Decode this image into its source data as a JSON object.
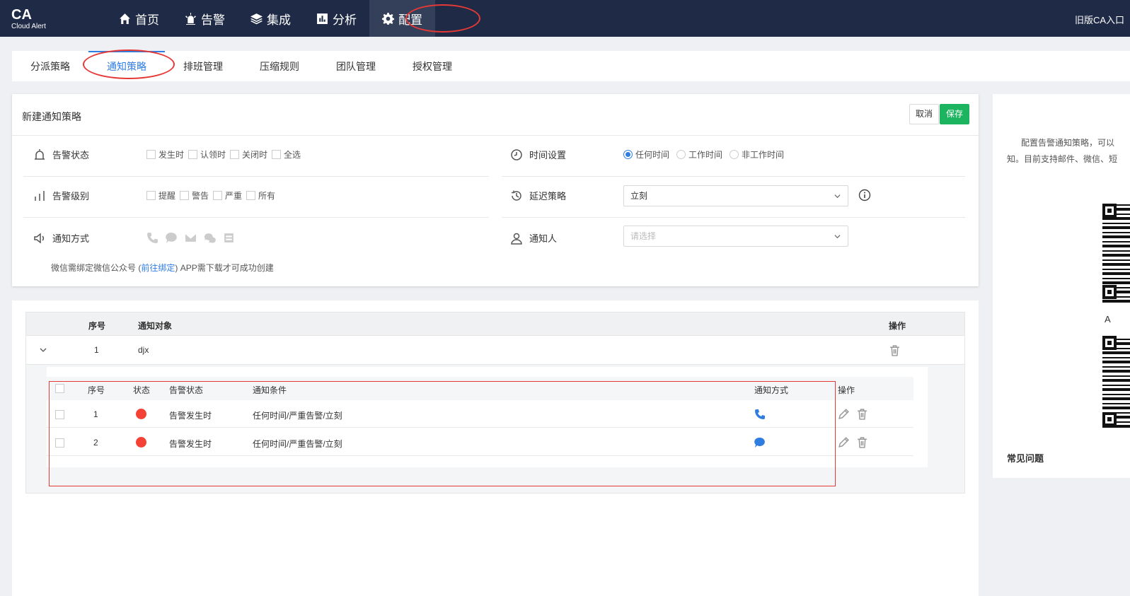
{
  "app": {
    "logo_big": "CA",
    "logo_small": "Cloud Alert",
    "old_entry": "旧版CA入口"
  },
  "nav": {
    "items": [
      {
        "label": "首页",
        "icon": "home-icon"
      },
      {
        "label": "告警",
        "icon": "alarm-icon"
      },
      {
        "label": "集成",
        "icon": "layers-icon"
      },
      {
        "label": "分析",
        "icon": "chart-icon"
      },
      {
        "label": "配置",
        "icon": "gear-icon",
        "active": true
      }
    ]
  },
  "tabs": [
    "分派策略",
    "通知策略",
    "排班管理",
    "压缩规则",
    "团队管理",
    "授权管理"
  ],
  "form": {
    "title": "新建通知策略",
    "cancel": "取消",
    "save": "保存",
    "alert_status": {
      "label": "告警状态",
      "options": [
        "发生时",
        "认领时",
        "关闭时",
        "全选"
      ]
    },
    "alert_level": {
      "label": "告警级别",
      "options": [
        "提醒",
        "警告",
        "严重",
        "所有"
      ]
    },
    "notify_method": {
      "label": "通知方式",
      "icons": [
        "phone-icon",
        "chat-bubble-icon",
        "mail-icon",
        "wechat-icon",
        "app-icon"
      ]
    },
    "hint_pre": "微信需绑定微信公众号 (",
    "hint_link": "前往绑定",
    "hint_post": ") APP需下载才可成功创建",
    "time_setting": {
      "label": "时间设置",
      "options": [
        "任何时间",
        "工作时间",
        "非工作时间"
      ],
      "selected": "任何时间"
    },
    "delay": {
      "label": "延迟策略",
      "value": "立刻"
    },
    "notifier": {
      "label": "通知人",
      "placeholder": "请选择"
    }
  },
  "table": {
    "headers": {
      "index": "序号",
      "target": "通知对象",
      "action": "操作"
    },
    "rows": [
      {
        "index": "1",
        "target": "djx"
      }
    ],
    "sub": {
      "headers": {
        "index": "序号",
        "state": "状态",
        "alert_status": "告警状态",
        "condition": "通知条件",
        "method": "通知方式",
        "action": "操作"
      },
      "rows": [
        {
          "index": "1",
          "alert_status": "告警发生时",
          "condition": "任何时间/严重告警/立刻",
          "method_icon": "phone-icon"
        },
        {
          "index": "2",
          "alert_status": "告警发生时",
          "condition": "任何时间/严重告警/立刻",
          "method_icon": "chat-bubble-icon"
        }
      ]
    }
  },
  "side": {
    "desc_line1": "配置告警通知策略，可以",
    "desc_line2": "知。目前支持邮件、微信、短",
    "app_letter": "A",
    "faq": "常见问题"
  },
  "colors": {
    "nav_bg": "#1f2b46",
    "accent": "#2f7de1",
    "save_green": "#1db45f",
    "status_red": "#f44336",
    "annotation_red": "#e53935"
  }
}
